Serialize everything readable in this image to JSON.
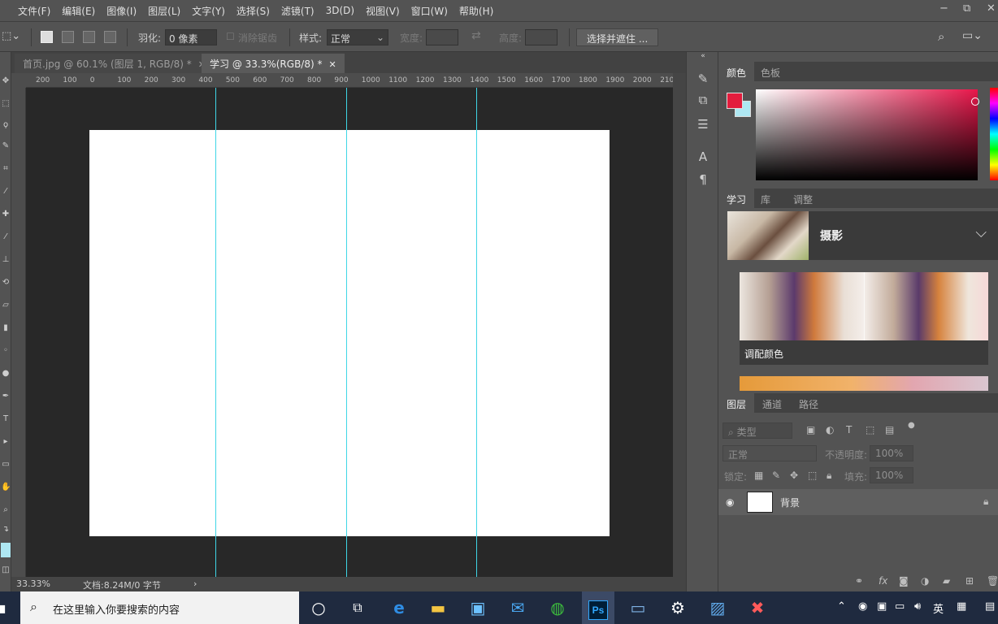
{
  "menu": [
    "文件(F)",
    "编辑(E)",
    "图像(I)",
    "图层(L)",
    "文字(Y)",
    "选择(S)",
    "滤镜(T)",
    "3D(D)",
    "视图(V)",
    "窗口(W)",
    "帮助(H)"
  ],
  "window_controls": {
    "minimize": "−",
    "restore": "⧉",
    "close": "✕"
  },
  "options": {
    "feather_label": "羽化:",
    "feather_value": "0 像素",
    "antialias_label": "消除锯齿",
    "style_label": "样式:",
    "style_value": "正常",
    "width_label": "宽度:",
    "height_label": "高度:",
    "swap_symbol": "⇄",
    "select_mask_button": "选择并遮住 ..."
  },
  "document_tabs": [
    {
      "label": "首页.jpg @ 60.1% (图层 1, RGB/8) *",
      "close": "✕"
    },
    {
      "label": "学习 @ 33.3%(RGB/8) *",
      "close": "✕"
    }
  ],
  "ruler_ticks": [
    "200",
    "100",
    "0",
    "100",
    "200",
    "300",
    "400",
    "500",
    "600",
    "700",
    "800",
    "900",
    "1000",
    "1100",
    "1200",
    "1300",
    "1400",
    "1500",
    "1600",
    "1700",
    "1800",
    "1900",
    "2000",
    "210"
  ],
  "status": {
    "zoom": "33.33%",
    "doc_info": "文档:8.24M/0 字节",
    "arrow": "›"
  },
  "color_panel": {
    "tabs": [
      "颜色",
      "色板"
    ],
    "foreground": "#e31c3d",
    "background": "#aee7f2"
  },
  "learn_panel": {
    "tabs": [
      "学习",
      "库",
      "调整"
    ],
    "topic": "摄影",
    "card_title": "调配颜色"
  },
  "layers_panel": {
    "tabs": [
      "图层",
      "通道",
      "路径"
    ],
    "filter_placeholder": "类型",
    "blend_mode": "正常",
    "opacity_label": "不透明度:",
    "opacity_value": "100%",
    "lock_label": "锁定:",
    "fill_label": "填充:",
    "fill_value": "100%",
    "layers": [
      {
        "name": "背景",
        "visible": true,
        "locked": true
      }
    ]
  },
  "taskbar": {
    "search_placeholder": "在这里输入你要搜索的内容",
    "ps_label": "Ps",
    "ime": "英"
  },
  "colors": {
    "guide": "#3fd6e6",
    "canvas": "#ffffff",
    "workspace": "#282828"
  }
}
